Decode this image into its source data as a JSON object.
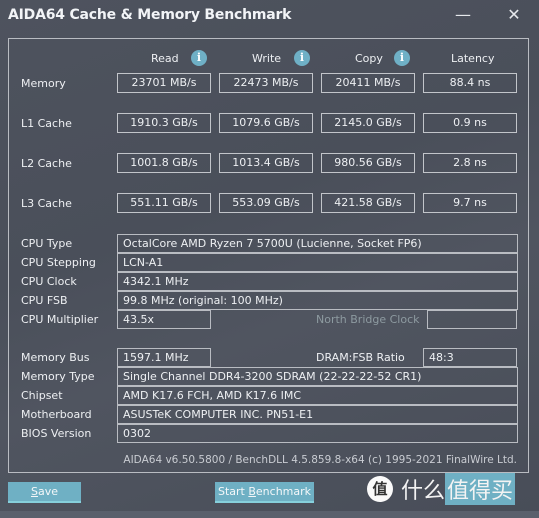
{
  "window": {
    "title": "AIDA64 Cache & Memory Benchmark",
    "minimize_icon": "minimize-icon",
    "close_icon": "close-icon",
    "minimize_glyph": "—",
    "close_glyph": "✕"
  },
  "columns": [
    {
      "label": "Read",
      "has_info": true
    },
    {
      "label": "Write",
      "has_info": true
    },
    {
      "label": "Copy",
      "has_info": true
    },
    {
      "label": "Latency",
      "has_info": false
    }
  ],
  "info_glyph": "i",
  "bench_rows": [
    {
      "label": "Memory",
      "read": "23701 MB/s",
      "write": "22473 MB/s",
      "copy": "20411 MB/s",
      "latency": "88.4 ns"
    },
    {
      "label": "L1 Cache",
      "read": "1910.3 GB/s",
      "write": "1079.6 GB/s",
      "copy": "2145.0 GB/s",
      "latency": "0.9 ns"
    },
    {
      "label": "L2 Cache",
      "read": "1001.8 GB/s",
      "write": "1013.4 GB/s",
      "copy": "980.56 GB/s",
      "latency": "2.8 ns"
    },
    {
      "label": "L3 Cache",
      "read": "551.11 GB/s",
      "write": "553.09 GB/s",
      "copy": "421.58 GB/s",
      "latency": "9.7 ns"
    }
  ],
  "cpu_info": {
    "cpu_type": {
      "label": "CPU Type",
      "value": "OctalCore AMD Ryzen 7 5700U  (Lucienne, Socket FP6)"
    },
    "cpu_stepping": {
      "label": "CPU Stepping",
      "value": "LCN-A1"
    },
    "cpu_clock": {
      "label": "CPU Clock",
      "value": "4342.1 MHz"
    },
    "cpu_fsb": {
      "label": "CPU FSB",
      "value": "99.8 MHz  (original: 100 MHz)"
    },
    "cpu_multiplier": {
      "label": "CPU Multiplier",
      "value": "43.5x"
    },
    "north_bridge_clock": {
      "label": "North Bridge Clock",
      "value": ""
    }
  },
  "mem_info": {
    "memory_bus": {
      "label": "Memory Bus",
      "value": "1597.1 MHz"
    },
    "dram_fsb_ratio": {
      "label": "DRAM:FSB Ratio",
      "value": "48:3"
    },
    "memory_type": {
      "label": "Memory Type",
      "value": "Single Channel DDR4-3200 SDRAM  (22-22-22-52 CR1)"
    },
    "chipset": {
      "label": "Chipset",
      "value": "AMD K17.6 FCH, AMD K17.6 IMC"
    },
    "motherboard": {
      "label": "Motherboard",
      "value": "ASUSTeK COMPUTER INC. PN51-E1"
    },
    "bios_version": {
      "label": "BIOS Version",
      "value": "0302"
    }
  },
  "footer": "AIDA64 v6.50.5800 / BenchDLL 4.5.859.8-x64  (c) 1995-2021 FinalWire Ltd.",
  "buttons": {
    "save": {
      "mnemonic": "S",
      "rest": "ave"
    },
    "start_benchmark": {
      "pre": "Start ",
      "mnemonic": "B",
      "rest": "enchmark"
    }
  },
  "watermark": {
    "circle_char": "值",
    "text_plain": "什么",
    "text_highlight": "值得买"
  }
}
